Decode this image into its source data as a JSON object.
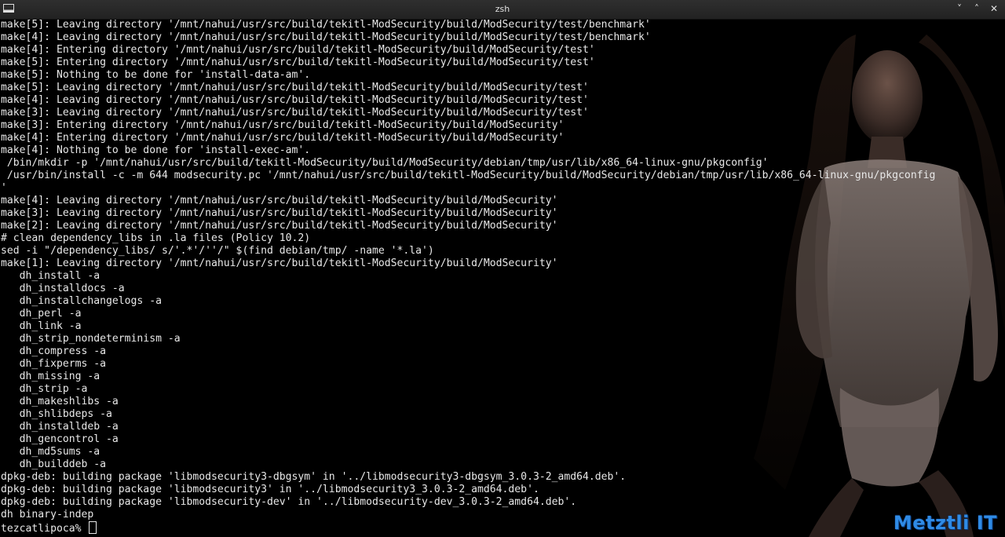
{
  "window": {
    "title": "zsh",
    "controls": {
      "minimize": "˅",
      "maximize": "˄",
      "close": "✕"
    }
  },
  "terminal": {
    "lines": [
      "make[5]: Leaving directory '/mnt/nahui/usr/src/build/tekitl-ModSecurity/build/ModSecurity/test/benchmark'",
      "make[4]: Leaving directory '/mnt/nahui/usr/src/build/tekitl-ModSecurity/build/ModSecurity/test/benchmark'",
      "make[4]: Entering directory '/mnt/nahui/usr/src/build/tekitl-ModSecurity/build/ModSecurity/test'",
      "make[5]: Entering directory '/mnt/nahui/usr/src/build/tekitl-ModSecurity/build/ModSecurity/test'",
      "make[5]: Nothing to be done for 'install-data-am'.",
      "make[5]: Leaving directory '/mnt/nahui/usr/src/build/tekitl-ModSecurity/build/ModSecurity/test'",
      "make[4]: Leaving directory '/mnt/nahui/usr/src/build/tekitl-ModSecurity/build/ModSecurity/test'",
      "make[3]: Leaving directory '/mnt/nahui/usr/src/build/tekitl-ModSecurity/build/ModSecurity/test'",
      "make[3]: Entering directory '/mnt/nahui/usr/src/build/tekitl-ModSecurity/build/ModSecurity'",
      "make[4]: Entering directory '/mnt/nahui/usr/src/build/tekitl-ModSecurity/build/ModSecurity'",
      "make[4]: Nothing to be done for 'install-exec-am'.",
      " /bin/mkdir -p '/mnt/nahui/usr/src/build/tekitl-ModSecurity/build/ModSecurity/debian/tmp/usr/lib/x86_64-linux-gnu/pkgconfig'",
      " /usr/bin/install -c -m 644 modsecurity.pc '/mnt/nahui/usr/src/build/tekitl-ModSecurity/build/ModSecurity/debian/tmp/usr/lib/x86_64-linux-gnu/pkgconfig",
      "'",
      "make[4]: Leaving directory '/mnt/nahui/usr/src/build/tekitl-ModSecurity/build/ModSecurity'",
      "make[3]: Leaving directory '/mnt/nahui/usr/src/build/tekitl-ModSecurity/build/ModSecurity'",
      "make[2]: Leaving directory '/mnt/nahui/usr/src/build/tekitl-ModSecurity/build/ModSecurity'",
      "# clean dependency_libs in .la files (Policy 10.2)",
      "sed -i \"/dependency_libs/ s/'.*'/''/\" $(find debian/tmp/ -name '*.la')",
      "make[1]: Leaving directory '/mnt/nahui/usr/src/build/tekitl-ModSecurity/build/ModSecurity'",
      "   dh_install -a",
      "   dh_installdocs -a",
      "   dh_installchangelogs -a",
      "   dh_perl -a",
      "   dh_link -a",
      "   dh_strip_nondeterminism -a",
      "   dh_compress -a",
      "   dh_fixperms -a",
      "   dh_missing -a",
      "   dh_strip -a",
      "   dh_makeshlibs -a",
      "   dh_shlibdeps -a",
      "   dh_installdeb -a",
      "   dh_gencontrol -a",
      "   dh_md5sums -a",
      "   dh_builddeb -a",
      "dpkg-deb: building package 'libmodsecurity3-dbgsym' in '../libmodsecurity3-dbgsym_3.0.3-2_amd64.deb'.",
      "dpkg-deb: building package 'libmodsecurity3' in '../libmodsecurity3_3.0.3-2_amd64.deb'.",
      "dpkg-deb: building package 'libmodsecurity-dev' in '../libmodsecurity-dev_3.0.3-2_amd64.deb'.",
      "dh binary-indep"
    ],
    "prompt": "tezcatlipoca% "
  },
  "watermark": "Metztli IT",
  "colors": {
    "background": "#000000",
    "text": "#e8e8e8",
    "watermark": "#2f8be6",
    "titlebar": "#2a2a2a"
  },
  "icons": {
    "app": "terminal-icon",
    "minimize": "chevron-down-icon",
    "maximize": "chevron-up-icon",
    "close": "close-icon"
  }
}
